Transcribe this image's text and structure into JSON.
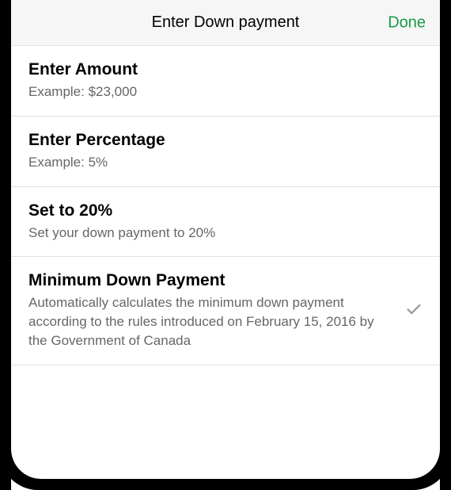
{
  "header": {
    "title": "Enter Down payment",
    "done_label": "Done"
  },
  "options": [
    {
      "title": "Enter Amount",
      "subtitle": "Example: $23,000",
      "selected": false
    },
    {
      "title": "Enter Percentage",
      "subtitle": "Example: 5%",
      "selected": false
    },
    {
      "title": "Set to 20%",
      "subtitle": "Set your down payment to 20%",
      "selected": false
    },
    {
      "title": "Minimum Down Payment",
      "subtitle": "Automatically calculates the minimum down payment according to the rules introduced on February 15, 2016 by the Government of Canada",
      "selected": true
    }
  ]
}
